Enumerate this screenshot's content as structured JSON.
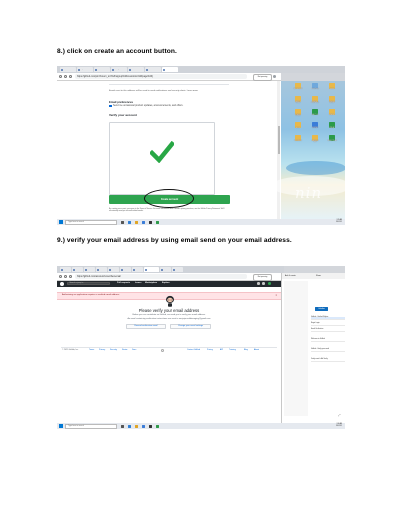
{
  "steps": [
    {
      "heading": "8.) click on create an account button."
    },
    {
      "heading": "9.) verify your email address by using email send on your email address."
    }
  ],
  "shot1": {
    "tabs": [
      "AP CTE",
      "https:/",
      "Welcom",
      "Verify",
      "Github",
      "ve  DI",
      "bd DS"
    ],
    "url": "https://github.com/join?return_to=%2Fsignup%2Fcustomize%2Fpage%2Fj",
    "not_paused": "Not pausing",
    "email_note": "Emails sent to this address will be used to send notifications and security alerts. Learn more",
    "pref_title": "Email preferences",
    "pref_text": "Send me occasional product updates, announcements, and offers.",
    "verify_title": "Verify your account",
    "create_button": "Create account",
    "terms": "By creating an account, you agree to the Terms of Service. For more information about GitHub's privacy practices, see the GitHub Privacy Statement. We'll occasionally send you account-related emails.",
    "taskbar_search": "Type here to search",
    "clock": [
      "3:35 AM",
      "8/6/2021"
    ],
    "watermark": "nin",
    "desktop_icons": [
      {
        "label": "NEW FOLDER",
        "color": "#e8b84a"
      },
      {
        "label": "Inbox(Drive)",
        "color": "#6fa8dc"
      },
      {
        "label": "Timelines",
        "color": "#e8b84a"
      },
      {
        "label": "SAMPLE CLASS",
        "color": "#e8b84a"
      },
      {
        "label": "GRADE 7 PORTFOLIO",
        "color": "#e8b84a"
      },
      {
        "label": "GRADE 8 INSIDE",
        "color": "#e8b84a"
      },
      {
        "label": "SCHOOL FORMS",
        "color": "#e8b84a"
      },
      {
        "label": "DAILY LOG",
        "color": "#2b9a4a"
      },
      {
        "label": "GRADE 7",
        "color": "#e8b84a"
      },
      {
        "label": "BOOK",
        "color": "#e8b84a"
      },
      {
        "label": "LEARNER",
        "color": "#3b7dd8"
      },
      {
        "label": "FRIDAY",
        "color": "#2b9a4a"
      },
      {
        "label": "PROGRESS",
        "color": "#e8b84a"
      },
      {
        "label": "LEARNING TASK",
        "color": "#e8b84a"
      },
      {
        "label": "WEEKLY PLAN",
        "color": "#2b9a4a"
      }
    ],
    "colors": {
      "button": "#2ea44f",
      "check": "#28a745"
    }
  },
  "shot2": {
    "tabs": [
      "AP CT",
      "Ve",
      "CM",
      "G",
      "Na",
      "Co",
      "Mi",
      "Pe",
      "Ve",
      "G"
    ],
    "url": "https://github.com/account/unverified-email",
    "not_paused": "Not pausing",
    "search_placeholder": "Search or jump to...",
    "nav": [
      "Pull requests",
      "Issues",
      "Marketplace",
      "Explore"
    ],
    "flash": "Authorizing an application requires a verified email address.",
    "title": "Please verify your email address",
    "sub1": "Before you can contribute on GitHub, we need you to verify your email address.",
    "sub2": "An email containing verification instructions was sent to nanjojocanlabimaging@gmail.com",
    "resend_button": "Resend verification email",
    "change_button": "Change your email settings",
    "footer": {
      "copyright": "© 2021 GitHub, Inc.",
      "left_links": [
        "Terms",
        "Privacy",
        "Security",
        "Status",
        "Docs"
      ],
      "right_links": [
        "Contact GitHub",
        "Pricing",
        "API",
        "Training",
        "Blog",
        "About"
      ]
    },
    "mail": {
      "top": [
        "Ask & create",
        "Show"
      ],
      "compose": "Unfollow",
      "items": [
        "GitHub - Verified Skyline",
        "Nuget Login",
        "Email Verification",
        "Welcome to GitHub",
        "GitHub - Verify your email",
        "Verify email - Ask Verify"
      ]
    },
    "taskbar_search": "Type here to search",
    "clock": [
      "3:36 AM",
      "8/6/2021"
    ]
  }
}
